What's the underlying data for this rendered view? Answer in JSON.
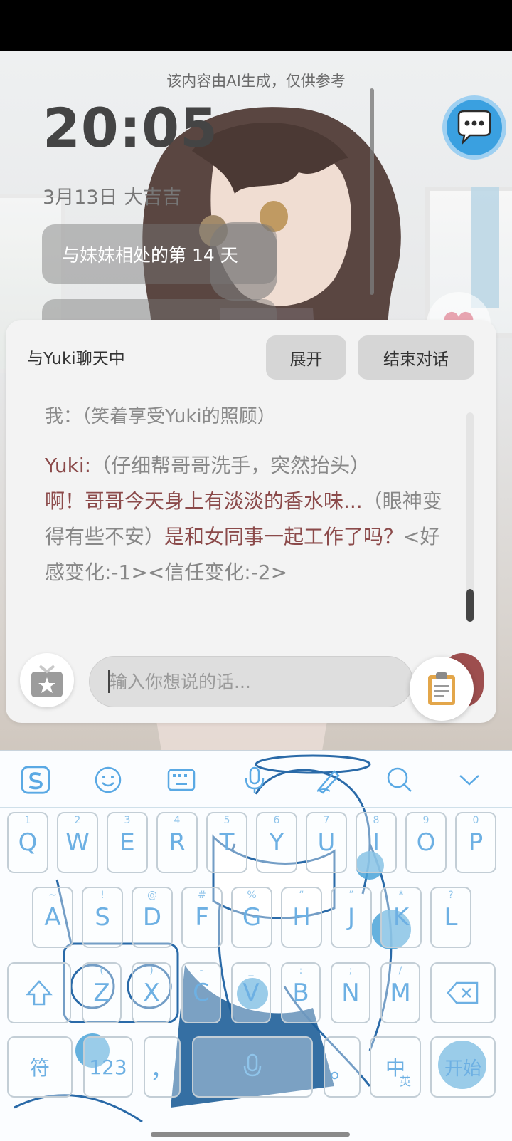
{
  "lock_overlay": {
    "ai_note": "该内容由AI生成，仅供参考",
    "time": "20:05",
    "date": "3月13日  大吉吉",
    "days_together": "与妹妹相处的第 14 天"
  },
  "chat": {
    "title": "与Yuki聊天中",
    "expand_label": "展开",
    "end_label": "结束对话",
    "prev_message_cut": "我：（笑着享受Yuki的照顾）",
    "message": {
      "name": "Yuki:",
      "action1": "（仔细帮哥哥洗手，突然抬头）",
      "speech1": "啊！哥哥今天身上有淡淡的香水味...",
      "action2": "（眼神变得有些不安）",
      "speech2": "是和女同事一起工作了吗？",
      "status": "<好感变化:-1><信任变化:-2>"
    },
    "input_placeholder": "输入你想说的话..."
  },
  "keyboard": {
    "row1": [
      {
        "k": "Q",
        "h": "1"
      },
      {
        "k": "W",
        "h": "2"
      },
      {
        "k": "E",
        "h": "3"
      },
      {
        "k": "R",
        "h": "4"
      },
      {
        "k": "T",
        "h": "5"
      },
      {
        "k": "Y",
        "h": "6"
      },
      {
        "k": "U",
        "h": "7"
      },
      {
        "k": "I",
        "h": "8"
      },
      {
        "k": "O",
        "h": "9"
      },
      {
        "k": "P",
        "h": "0"
      }
    ],
    "row2": [
      {
        "k": "A",
        "h": "~"
      },
      {
        "k": "S",
        "h": "!"
      },
      {
        "k": "D",
        "h": "@"
      },
      {
        "k": "F",
        "h": "#"
      },
      {
        "k": "G",
        "h": "%"
      },
      {
        "k": "H",
        "h": "“"
      },
      {
        "k": "J",
        "h": "”"
      },
      {
        "k": "K",
        "h": "*"
      },
      {
        "k": "L",
        "h": "?"
      }
    ],
    "row3": [
      {
        "k": "Z",
        "h": "("
      },
      {
        "k": "X",
        "h": ")"
      },
      {
        "k": "C",
        "h": "-"
      },
      {
        "k": "V",
        "h": "_"
      },
      {
        "k": "B",
        "h": ":"
      },
      {
        "k": "N",
        "h": ";"
      },
      {
        "k": "M",
        "h": "/"
      }
    ],
    "sym_label": "符",
    "num_label": "123",
    "comma_label": "，",
    "period_label": "。",
    "lang_label": "中",
    "lang_sub_label": "英",
    "start_label": "开始"
  },
  "colors": {
    "speech_accent": "#8b4a4a",
    "keyboard_accent": "#6db0e3"
  }
}
